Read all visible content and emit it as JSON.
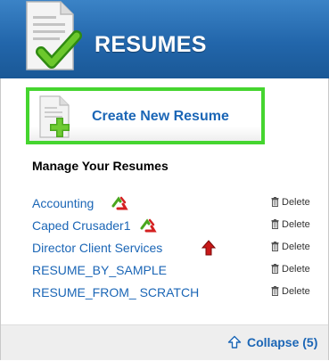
{
  "header": {
    "title": "RESUMES",
    "logo_icon": "resume-document-checkmark-icon"
  },
  "create": {
    "label": "Create New Resume",
    "icon": "document-plus-icon"
  },
  "manage": {
    "title": "Manage Your Resumes"
  },
  "resumes": [
    {
      "name": "Accounting",
      "status_icon": "recycle-arrows-icon"
    },
    {
      "name": "Caped Crusader1",
      "status_icon": "recycle-arrows-icon"
    },
    {
      "name": "Director Client Services",
      "status_icon": "red-up-arrow-icon"
    },
    {
      "name": "RESUME_BY_SAMPLE",
      "status_icon": ""
    },
    {
      "name": "RESUME_FROM_ SCRATCH",
      "status_icon": ""
    }
  ],
  "delete_label": "Delete",
  "footer": {
    "collapse_label": "Collapse (5)",
    "collapse_icon": "up-arrow-outline-icon"
  },
  "colors": {
    "header_blue": "#2266ab",
    "link_blue": "#1b66b6",
    "highlight_green": "#45d52f"
  }
}
